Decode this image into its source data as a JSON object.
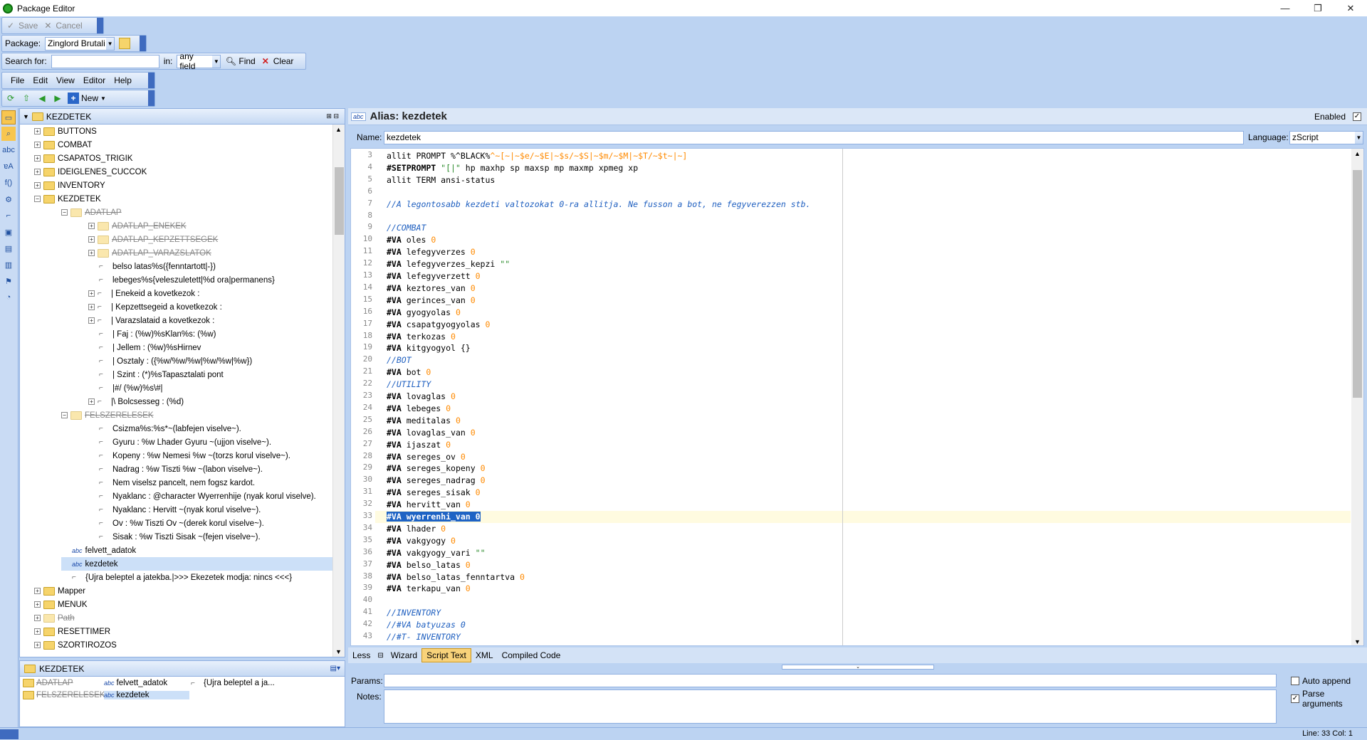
{
  "window": {
    "title": "Package Editor",
    "minimize": "—",
    "restore": "❐",
    "close": "✕"
  },
  "toolbar1": {
    "save": "Save",
    "cancel": "Cancel"
  },
  "toolbar2": {
    "package_label": "Package:",
    "package_value": "Zinglord Brutali"
  },
  "search": {
    "label": "Search for:",
    "value": "",
    "in_label": "in:",
    "field_value": "any field",
    "find": "Find",
    "clear": "Clear"
  },
  "menu": {
    "file": "File",
    "edit": "Edit",
    "view": "View",
    "editor": "Editor",
    "help": "Help"
  },
  "toolbar4": {
    "new": "New"
  },
  "tree": {
    "root": "KEZDETEK",
    "nodes": [
      {
        "label": "BUTTONS",
        "kind": "folder",
        "indent": 0,
        "exp": "+"
      },
      {
        "label": "COMBAT",
        "kind": "folder",
        "indent": 0,
        "exp": "+"
      },
      {
        "label": "CSAPATOS_TRIGIK",
        "kind": "folder",
        "indent": 0,
        "exp": "+"
      },
      {
        "label": "IDEIGLENES_CUCCOK",
        "kind": "folder",
        "indent": 0,
        "exp": "+"
      },
      {
        "label": "INVENTORY",
        "kind": "folder",
        "indent": 0,
        "exp": "+"
      },
      {
        "label": "KEZDETEK",
        "kind": "folder",
        "indent": 0,
        "exp": "−"
      },
      {
        "label": "ADATLAP",
        "kind": "folder-dis",
        "indent": 1,
        "exp": "−"
      },
      {
        "label": "ADATLAP_ENEKEK",
        "kind": "folder-dis",
        "indent": 2,
        "exp": "+"
      },
      {
        "label": "ADATLAP_KEPZETTSEGEK",
        "kind": "folder-dis",
        "indent": 2,
        "exp": "+"
      },
      {
        "label": "ADATLAP_VARAZSLATOK",
        "kind": "folder-dis",
        "indent": 2,
        "exp": "+"
      },
      {
        "label": "belso latas%s({fenntartott|-})",
        "kind": "trig",
        "indent": 2,
        "exp": ""
      },
      {
        "label": "lebeges%s{veleszuletett|%d ora|permanens}",
        "kind": "trig",
        "indent": 2,
        "exp": ""
      },
      {
        "label": "|  Enekeid a kovetkezok :",
        "kind": "trig",
        "indent": 2,
        "exp": "+"
      },
      {
        "label": "|  Kepzettsegeid a kovetkezok :",
        "kind": "trig",
        "indent": 2,
        "exp": "+"
      },
      {
        "label": "|  Varazslataid a kovetkezok :",
        "kind": "trig",
        "indent": 2,
        "exp": "+"
      },
      {
        "label": "| Faj    : (%w)%sKlan%s: (%w)",
        "kind": "trig",
        "indent": 2,
        "exp": ""
      },
      {
        "label": "| Jellem  : (%w)%sHirnev",
        "kind": "trig",
        "indent": 2,
        "exp": ""
      },
      {
        "label": "| Osztaly : ({%w/%w/%w|%w/%w|%w})",
        "kind": "trig",
        "indent": 2,
        "exp": ""
      },
      {
        "label": "| Szint   : (*)%sTapasztalati pont",
        "kind": "trig",
        "indent": 2,
        "exp": ""
      },
      {
        "label": "|#/ (%w)%s\\#|",
        "kind": "trig",
        "indent": 2,
        "exp": ""
      },
      {
        "label": "|\\ Bolcsesseg : (%d)",
        "kind": "trig",
        "indent": 2,
        "exp": "+"
      },
      {
        "label": "FELSZERELESEK",
        "kind": "folder-dis",
        "indent": 1,
        "exp": "−"
      },
      {
        "label": "Csizma%s:%s*~(labfejen viselve~).",
        "kind": "trig",
        "indent": 2,
        "exp": ""
      },
      {
        "label": "Gyuru       : %w Lhader Gyuru ~(ujjon viselve~).",
        "kind": "trig",
        "indent": 2,
        "exp": ""
      },
      {
        "label": "Kopeny      : %w Nemesi %w ~(torzs korul viselve~).",
        "kind": "trig",
        "indent": 2,
        "exp": ""
      },
      {
        "label": "Nadrag      : %w Tiszti %w ~(labon viselve~).",
        "kind": "trig",
        "indent": 2,
        "exp": ""
      },
      {
        "label": "Nem viselsz pancelt, nem fogsz kardot.",
        "kind": "trig",
        "indent": 2,
        "exp": ""
      },
      {
        "label": "Nyaklanc    : @character Wyerrenhije (nyak korul viselve).",
        "kind": "trig",
        "indent": 2,
        "exp": ""
      },
      {
        "label": "Nyaklanc    : Hervitt ~(nyak korul viselve~).",
        "kind": "trig",
        "indent": 2,
        "exp": ""
      },
      {
        "label": "Ov          : %w Tiszti Ov ~(derek korul viselve~).",
        "kind": "trig",
        "indent": 2,
        "exp": ""
      },
      {
        "label": "Sisak       : %w Tiszti Sisak ~(fejen viselve~).",
        "kind": "trig",
        "indent": 2,
        "exp": ""
      },
      {
        "label": "felvett_adatok",
        "kind": "alias",
        "indent": 1,
        "exp": ""
      },
      {
        "label": "kezdetek",
        "kind": "alias-sel",
        "indent": 1,
        "exp": ""
      },
      {
        "label": "{Ujra beleptel a jatekba.|>>> Ekezetek modja: nincs <<<}",
        "kind": "trig",
        "indent": 1,
        "exp": ""
      },
      {
        "label": "Mapper",
        "kind": "folder",
        "indent": 0,
        "exp": "+"
      },
      {
        "label": "MENUK",
        "kind": "folder",
        "indent": 0,
        "exp": "+"
      },
      {
        "label": "Path",
        "kind": "folder-dis",
        "indent": 0,
        "exp": "+"
      },
      {
        "label": "RESETTIMER",
        "kind": "folder",
        "indent": 0,
        "exp": "+"
      },
      {
        "label": "SZORTIROZOS",
        "kind": "folder",
        "indent": 0,
        "exp": "+"
      }
    ]
  },
  "bottom": {
    "title": "KEZDETEK",
    "items": [
      {
        "label": "ADATLAP",
        "kind": "folder-dis"
      },
      {
        "label": "FELSZERELESEK",
        "kind": "folder-dis"
      },
      {
        "label": "felvett_adatok",
        "kind": "alias"
      },
      {
        "label": "kezdetek",
        "kind": "alias-sel"
      },
      {
        "label": "{Ujra beleptel a ja...",
        "kind": "trig"
      }
    ]
  },
  "editor": {
    "header": "Alias: kezdetek",
    "abc": "abc",
    "enabled_label": "Enabled",
    "name_label": "Name:",
    "name_value": "kezdetek",
    "language_label": "Language:",
    "language_value": "zScript",
    "lines": [
      {
        "n": "3",
        "parts": [
          [
            "",
            "allit PROMPT %^BLACK%"
          ],
          [
            "num",
            "^~[~|~$e/~$E|~$s/~$S|~$m/~$M|~$T/~$t~|~]"
          ]
        ]
      },
      {
        "n": "4",
        "parts": [
          [
            "kw",
            "#SETPROMPT "
          ],
          [
            "str",
            "\"[|\""
          ],
          [
            "",
            " hp maxhp sp maxsp mp maxmp xpmeg xp"
          ]
        ]
      },
      {
        "n": "5",
        "parts": [
          [
            "",
            "allit TERM ansi-status"
          ]
        ]
      },
      {
        "n": "6",
        "parts": [
          [
            "",
            ""
          ]
        ]
      },
      {
        "n": "7",
        "parts": [
          [
            "cmt",
            "//A legontosabb kezdeti valtozokat 0-ra allitja. Ne fusson a bot, ne fegyverezzen stb."
          ]
        ]
      },
      {
        "n": "8",
        "parts": [
          [
            "",
            ""
          ]
        ]
      },
      {
        "n": "9",
        "parts": [
          [
            "cmt",
            "//COMBAT"
          ]
        ]
      },
      {
        "n": "10",
        "parts": [
          [
            "kw",
            "#VA"
          ],
          [
            "",
            " oles "
          ],
          [
            "num",
            "0"
          ]
        ]
      },
      {
        "n": "11",
        "parts": [
          [
            "kw",
            "#VA"
          ],
          [
            "",
            " lefegyverzes "
          ],
          [
            "num",
            "0"
          ]
        ]
      },
      {
        "n": "12",
        "parts": [
          [
            "kw",
            "#VA"
          ],
          [
            "",
            " lefegyverzes_kepzi "
          ],
          [
            "str",
            "\"\""
          ]
        ]
      },
      {
        "n": "13",
        "parts": [
          [
            "kw",
            "#VA"
          ],
          [
            "",
            " lefegyverzett "
          ],
          [
            "num",
            "0"
          ]
        ]
      },
      {
        "n": "14",
        "parts": [
          [
            "kw",
            "#VA"
          ],
          [
            "",
            " keztores_van "
          ],
          [
            "num",
            "0"
          ]
        ]
      },
      {
        "n": "15",
        "parts": [
          [
            "kw",
            "#VA"
          ],
          [
            "",
            " gerinces_van "
          ],
          [
            "num",
            "0"
          ]
        ]
      },
      {
        "n": "16",
        "parts": [
          [
            "kw",
            "#VA"
          ],
          [
            "",
            " gyogyolas "
          ],
          [
            "num",
            "0"
          ]
        ]
      },
      {
        "n": "17",
        "parts": [
          [
            "kw",
            "#VA"
          ],
          [
            "",
            " csapatgyogyolas "
          ],
          [
            "num",
            "0"
          ]
        ]
      },
      {
        "n": "18",
        "parts": [
          [
            "kw",
            "#VA"
          ],
          [
            "",
            " terkozas "
          ],
          [
            "num",
            "0"
          ]
        ]
      },
      {
        "n": "19",
        "parts": [
          [
            "kw",
            "#VA"
          ],
          [
            "",
            " kitgyogyol {}"
          ]
        ]
      },
      {
        "n": "20",
        "parts": [
          [
            "cmt",
            "//BOT"
          ]
        ]
      },
      {
        "n": "21",
        "parts": [
          [
            "kw",
            "#VA"
          ],
          [
            "",
            " bot "
          ],
          [
            "num",
            "0"
          ]
        ]
      },
      {
        "n": "22",
        "parts": [
          [
            "cmt",
            "//UTILITY"
          ]
        ]
      },
      {
        "n": "23",
        "parts": [
          [
            "kw",
            "#VA"
          ],
          [
            "",
            " lovaglas "
          ],
          [
            "num",
            "0"
          ]
        ]
      },
      {
        "n": "24",
        "parts": [
          [
            "kw",
            "#VA"
          ],
          [
            "",
            " lebeges "
          ],
          [
            "num",
            "0"
          ]
        ]
      },
      {
        "n": "25",
        "parts": [
          [
            "kw",
            "#VA"
          ],
          [
            "",
            " meditalas "
          ],
          [
            "num",
            "0"
          ]
        ]
      },
      {
        "n": "26",
        "parts": [
          [
            "kw",
            "#VA"
          ],
          [
            "",
            " lovaglas_van "
          ],
          [
            "num",
            "0"
          ]
        ]
      },
      {
        "n": "27",
        "parts": [
          [
            "kw",
            "#VA"
          ],
          [
            "",
            " ijaszat "
          ],
          [
            "num",
            "0"
          ]
        ]
      },
      {
        "n": "28",
        "parts": [
          [
            "kw",
            "#VA"
          ],
          [
            "",
            " sereges_ov "
          ],
          [
            "num",
            "0"
          ]
        ]
      },
      {
        "n": "29",
        "parts": [
          [
            "kw",
            "#VA"
          ],
          [
            "",
            " sereges_kopeny "
          ],
          [
            "num",
            "0"
          ]
        ]
      },
      {
        "n": "30",
        "parts": [
          [
            "kw",
            "#VA"
          ],
          [
            "",
            " sereges_nadrag "
          ],
          [
            "num",
            "0"
          ]
        ]
      },
      {
        "n": "31",
        "parts": [
          [
            "kw",
            "#VA"
          ],
          [
            "",
            " sereges_sisak "
          ],
          [
            "num",
            "0"
          ]
        ]
      },
      {
        "n": "32",
        "parts": [
          [
            "kw",
            "#VA"
          ],
          [
            "",
            " hervitt_van "
          ],
          [
            "num",
            "0"
          ]
        ]
      },
      {
        "n": "33",
        "parts": [
          [
            "sel",
            "#VA wyerrenhi_van 0"
          ]
        ]
      },
      {
        "n": "34",
        "parts": [
          [
            "kw",
            "#VA"
          ],
          [
            "",
            " lhader "
          ],
          [
            "num",
            "0"
          ]
        ]
      },
      {
        "n": "35",
        "parts": [
          [
            "kw",
            "#VA"
          ],
          [
            "",
            " vakgyogy "
          ],
          [
            "num",
            "0"
          ]
        ]
      },
      {
        "n": "36",
        "parts": [
          [
            "kw",
            "#VA"
          ],
          [
            "",
            " vakgyogy_vari "
          ],
          [
            "str",
            "\"\""
          ]
        ]
      },
      {
        "n": "37",
        "parts": [
          [
            "kw",
            "#VA"
          ],
          [
            "",
            " belso_latas "
          ],
          [
            "num",
            "0"
          ]
        ]
      },
      {
        "n": "38",
        "parts": [
          [
            "kw",
            "#VA"
          ],
          [
            "",
            " belso_latas_fenntartva "
          ],
          [
            "num",
            "0"
          ]
        ]
      },
      {
        "n": "39",
        "parts": [
          [
            "kw",
            "#VA"
          ],
          [
            "",
            " terkapu_van "
          ],
          [
            "num",
            "0"
          ]
        ]
      },
      {
        "n": "40",
        "parts": [
          [
            "",
            ""
          ]
        ]
      },
      {
        "n": "41",
        "parts": [
          [
            "cmt",
            "//INVENTORY"
          ]
        ]
      },
      {
        "n": "42",
        "parts": [
          [
            "cmt",
            "//#VA batyuzas 0"
          ]
        ]
      },
      {
        "n": "43",
        "parts": [
          [
            "cmt",
            "//#T- INVENTORY"
          ]
        ]
      }
    ],
    "tabs": {
      "less": "Less",
      "wizard": "Wizard",
      "script_text": "Script Text",
      "xml": "XML",
      "compiled": "Compiled Code"
    },
    "params_label": "Params:",
    "notes_label": "Notes:",
    "auto_append": "Auto append",
    "parse_arguments": "Parse arguments"
  },
  "status": {
    "linecol": "Line: 33 Col: 1"
  }
}
